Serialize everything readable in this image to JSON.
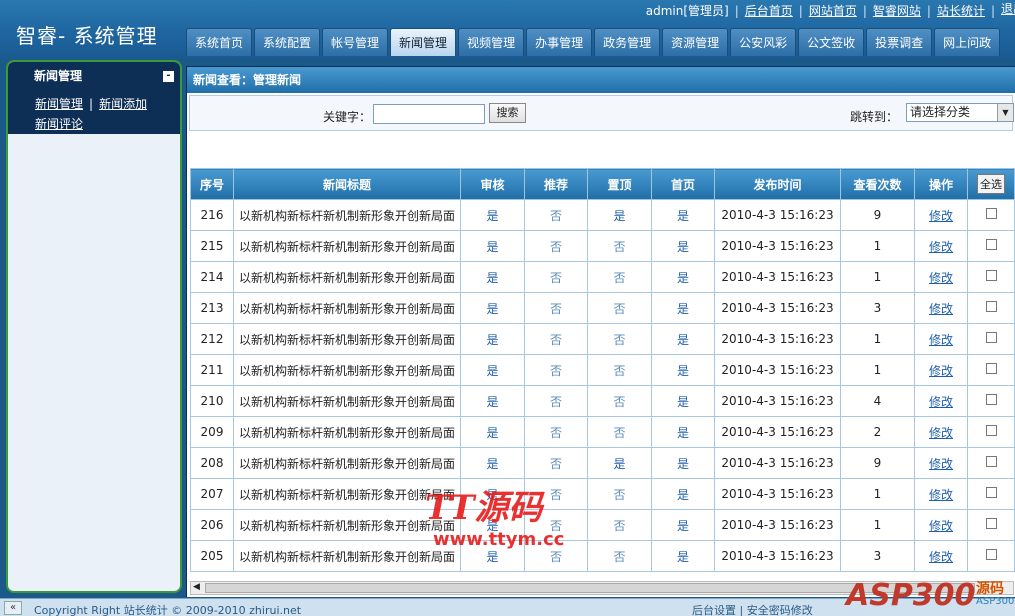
{
  "header": {
    "logo": "智睿- 系统管理",
    "user": "admin[管理员]",
    "links": [
      "后台首页",
      "网站首页",
      "智睿网站",
      "站长统计"
    ],
    "exit": "退出"
  },
  "nav": {
    "tabs": [
      "系统首页",
      "系统配置",
      "帐号管理",
      "新闻管理",
      "视频管理",
      "办事管理",
      "政务管理",
      "资源管理",
      "公安风彩",
      "公文签收",
      "投票调查",
      "网上问政"
    ],
    "active_index": 3
  },
  "sidebar": {
    "title": "新闻管理",
    "toggle": "-",
    "links": [
      "新闻管理",
      "新闻添加",
      "新闻评论"
    ]
  },
  "main": {
    "title": "新闻查看：管理新闻",
    "keyword_label": "关键字：",
    "keyword_value": "",
    "search_button": "搜索",
    "jump_label": "跳转到：",
    "jump_select": "请选择分类"
  },
  "table": {
    "headers": [
      "序号",
      "新闻标题",
      "审核",
      "推荐",
      "置顶",
      "首页",
      "发布时间",
      "查看次数",
      "操作"
    ],
    "select_all": "全选",
    "edit_label": "修改",
    "rows": [
      {
        "id": "216",
        "title": "以新机构新标杆新机制新形象开创新局面",
        "audit": "是",
        "recommend": "否",
        "top": "是",
        "home": "是",
        "time": "2010-4-3 15:16:23",
        "views": "9"
      },
      {
        "id": "215",
        "title": "以新机构新标杆新机制新形象开创新局面",
        "audit": "是",
        "recommend": "否",
        "top": "否",
        "home": "是",
        "time": "2010-4-3 15:16:23",
        "views": "1"
      },
      {
        "id": "214",
        "title": "以新机构新标杆新机制新形象开创新局面",
        "audit": "是",
        "recommend": "否",
        "top": "否",
        "home": "是",
        "time": "2010-4-3 15:16:23",
        "views": "1"
      },
      {
        "id": "213",
        "title": "以新机构新标杆新机制新形象开创新局面",
        "audit": "是",
        "recommend": "否",
        "top": "否",
        "home": "是",
        "time": "2010-4-3 15:16:23",
        "views": "3"
      },
      {
        "id": "212",
        "title": "以新机构新标杆新机制新形象开创新局面",
        "audit": "是",
        "recommend": "否",
        "top": "否",
        "home": "是",
        "time": "2010-4-3 15:16:23",
        "views": "1"
      },
      {
        "id": "211",
        "title": "以新机构新标杆新机制新形象开创新局面",
        "audit": "是",
        "recommend": "否",
        "top": "否",
        "home": "是",
        "time": "2010-4-3 15:16:23",
        "views": "1"
      },
      {
        "id": "210",
        "title": "以新机构新标杆新机制新形象开创新局面",
        "audit": "是",
        "recommend": "否",
        "top": "否",
        "home": "是",
        "time": "2010-4-3 15:16:23",
        "views": "4"
      },
      {
        "id": "209",
        "title": "以新机构新标杆新机制新形象开创新局面",
        "audit": "是",
        "recommend": "否",
        "top": "否",
        "home": "是",
        "time": "2010-4-3 15:16:23",
        "views": "2"
      },
      {
        "id": "208",
        "title": "以新机构新标杆新机制新形象开创新局面",
        "audit": "是",
        "recommend": "否",
        "top": "是",
        "home": "是",
        "time": "2010-4-3 15:16:23",
        "views": "9"
      },
      {
        "id": "207",
        "title": "以新机构新标杆新机制新形象开创新局面",
        "audit": "是",
        "recommend": "否",
        "top": "否",
        "home": "是",
        "time": "2010-4-3 15:16:23",
        "views": "1"
      },
      {
        "id": "206",
        "title": "以新机构新标杆新机制新形象开创新局面",
        "audit": "是",
        "recommend": "否",
        "top": "否",
        "home": "是",
        "time": "2010-4-3 15:16:23",
        "views": "1"
      },
      {
        "id": "205",
        "title": "以新机构新标杆新机制新形象开创新局面",
        "audit": "是",
        "recommend": "否",
        "top": "否",
        "home": "是",
        "time": "2010-4-3 15:16:23",
        "views": "3"
      }
    ]
  },
  "watermark": {
    "line1": "TT源码",
    "line2": "www.ttym.cc",
    "logo_main": "ASP300",
    "logo_sub": "源码",
    "logo_url": "ASP300.COM"
  },
  "footer": {
    "collapse": "«",
    "copyright": "Copyright Right 站长统计 © 2009-2010 zhirui.net",
    "right_links": [
      "后台设置",
      "安全密码修改"
    ]
  }
}
